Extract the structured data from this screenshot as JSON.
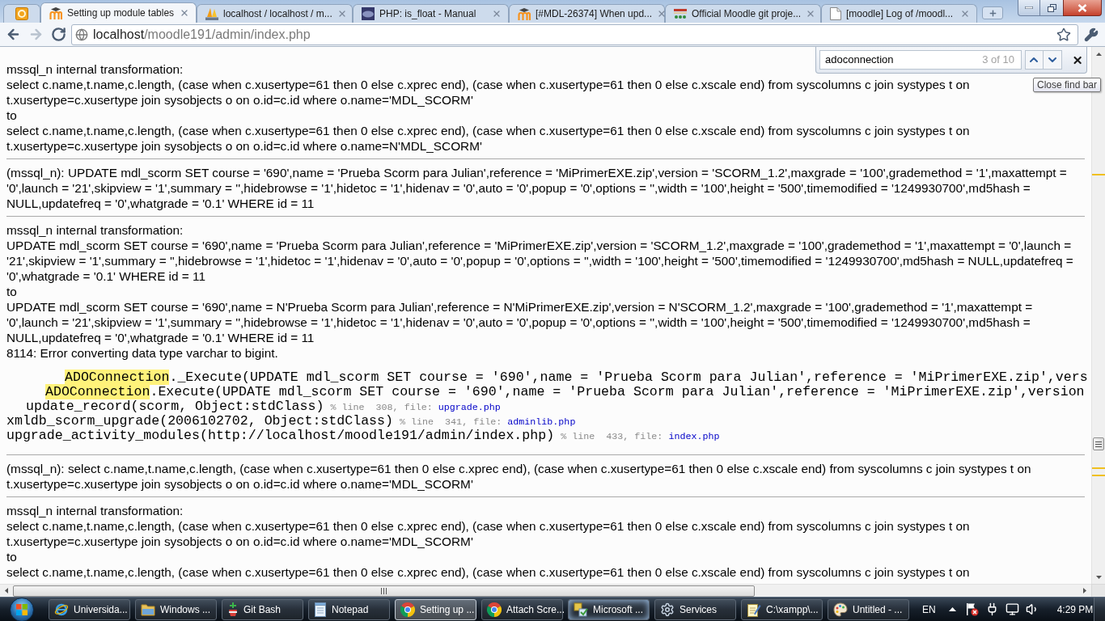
{
  "tabs": [
    {
      "kind": "pinned",
      "selected": false
    },
    {
      "kind": "page",
      "title": "Setting up module tables",
      "selected": true
    },
    {
      "kind": "page",
      "title": "localhost / localhost / m...",
      "selected": false
    },
    {
      "kind": "page",
      "title": "PHP: is_float - Manual",
      "selected": false
    },
    {
      "kind": "page",
      "title": "[#MDL-26374] When upd...",
      "selected": false
    },
    {
      "kind": "page",
      "title": "Official Moodle git proje...",
      "selected": false
    },
    {
      "kind": "page",
      "title": "[moodle] Log of /moodl...",
      "selected": false
    }
  ],
  "nav_buttons": [
    {
      "disabled": false
    },
    {
      "disabled": true
    },
    {
      "disabled": false
    }
  ],
  "address": {
    "host": "localhost",
    "path": "/moodle191/admin/index.php"
  },
  "find_bar": {
    "query": "adoconnection",
    "count": "3 of 10"
  },
  "tooltip": "Close find bar",
  "log": [
    {
      "kind": "transformation",
      "heading": "mssql_n internal transformation:",
      "from": "select c.name,t.name,c.length, (case when c.xusertype=61 then 0 else c.xprec end), (case when c.xusertype=61 then 0 else c.xscale end) from syscolumns c join systypes t on t.xusertype=c.xusertype join sysobjects o on o.id=c.id where o.name='MDL_SCORM'",
      "to_label": "to",
      "to": "select c.name,t.name,c.length, (case when c.xusertype=61 then 0 else c.xprec end), (case when c.xusertype=61 then 0 else c.xscale end) from syscolumns c join systypes t on t.xusertype=c.xusertype join sysobjects o on o.id=c.id where o.name=N'MDL_SCORM'"
    },
    {
      "kind": "query",
      "text": "(mssql_n): UPDATE mdl_scorm SET course = '690',name = 'Prueba Scorm para Julian',reference = 'MiPrimerEXE.zip',version = 'SCORM_1.2',maxgrade = '100',grademethod = '1',maxattempt = '0',launch = '21',skipview = '1',summary = '',hidebrowse = '1',hidetoc = '1',hidenav = '0',auto = '0',popup = '0',options = '',width = '100',height = '500',timemodified = '1249930700',md5hash = NULL,updatefreq = '0',whatgrade = '0.1' WHERE id = 11"
    },
    {
      "kind": "transformation",
      "heading": "mssql_n internal transformation:",
      "from": "UPDATE mdl_scorm SET course = '690',name = 'Prueba Scorm para Julian',reference = 'MiPrimerEXE.zip',version = 'SCORM_1.2',maxgrade = '100',grademethod = '1',maxattempt = '0',launch = '21',skipview = '1',summary = '',hidebrowse = '1',hidetoc = '1',hidenav = '0',auto = '0',popup = '0',options = '',width = '100',height = '500',timemodified = '1249930700',md5hash = NULL,updatefreq = '0',whatgrade = '0.1' WHERE id = 11",
      "to_label": "to",
      "to": "UPDATE mdl_scorm SET course = '690',name = N'Prueba Scorm para Julian',reference = N'MiPrimerEXE.zip',version = N'SCORM_1.2',maxgrade = '100',grademethod = '1',maxattempt = '0',launch = '21',skipview = '1',summary = '',hidebrowse = '1',hidetoc = '1',hidenav = '0',auto = '0',popup = '0',options = '',width = '100',height = '500',timemodified = '1249930700',md5hash = NULL,updatefreq = '0',whatgrade = '0.1' WHERE id = 11",
      "error": "8114: Error converting data type varchar to bigint.",
      "backtrace": [
        {
          "match": "ADOConnection",
          "call": "._Execute(UPDATE mdl_scorm SET course = '690',name = 'Prueba Scorm para Julian',reference = 'MiPrimerEXE.zip',vers"
        },
        {
          "match": "ADOConnection",
          "call": ".Execute(UPDATE mdl_scorm SET course = '690',name = 'Prueba Scorm para Julian',reference = 'MiPrimerEXE.zip',version"
        },
        {
          "call": "update_record(scorm, Object:stdClass)",
          "line_info": "% line  308, file:",
          "file": "upgrade.php"
        },
        {
          "call": "xmldb_scorm_upgrade(2006102702, Object:stdClass)",
          "line_info": "% line  341, file:",
          "file": "adminlib.php"
        },
        {
          "call": "upgrade_activity_modules(http://localhost/moodle191/admin/index.php)",
          "line_info": "% line  433, file:",
          "file": "index.php"
        }
      ]
    },
    {
      "kind": "query",
      "text": "(mssql_n): select c.name,t.name,c.length, (case when c.xusertype=61 then 0 else c.xprec end), (case when c.xusertype=61 then 0 else c.xscale end) from syscolumns c join systypes t on t.xusertype=c.xusertype join sysobjects o on o.id=c.id where o.name='MDL_SCORM'"
    },
    {
      "kind": "transformation",
      "heading": "mssql_n internal transformation:",
      "from": "select c.name,t.name,c.length, (case when c.xusertype=61 then 0 else c.xprec end), (case when c.xusertype=61 then 0 else c.xscale end) from syscolumns c join systypes t on t.xusertype=c.xusertype join sysobjects o on o.id=c.id where o.name='MDL_SCORM'",
      "to_label": "to",
      "to": "select c.name,t.name,c.length, (case when c.xusertype=61 then 0 else c.xprec end), (case when c.xusertype=61 then 0 else c.xscale end) from syscolumns c join systypes t on"
    }
  ],
  "taskbar": {
    "items": [
      {
        "label": "Universida...",
        "selected": false,
        "hovered": false
      },
      {
        "label": "Windows ...",
        "selected": false,
        "hovered": false
      },
      {
        "label": "Git Bash",
        "selected": false,
        "hovered": false
      },
      {
        "label": "Notepad",
        "selected": false,
        "hovered": false
      },
      {
        "label": "Setting up ...",
        "selected": true,
        "hovered": false
      },
      {
        "label": "Attach Scre...",
        "selected": false,
        "hovered": false
      },
      {
        "label": "Microsoft ...",
        "selected": false,
        "hovered": true
      },
      {
        "label": "Services",
        "selected": false,
        "hovered": false
      },
      {
        "label": "C:\\xampp\\...",
        "selected": false,
        "hovered": false
      },
      {
        "label": "Untitled - ...",
        "selected": false,
        "hovered": false
      }
    ],
    "language": "EN",
    "clock": "4:29 PM"
  }
}
